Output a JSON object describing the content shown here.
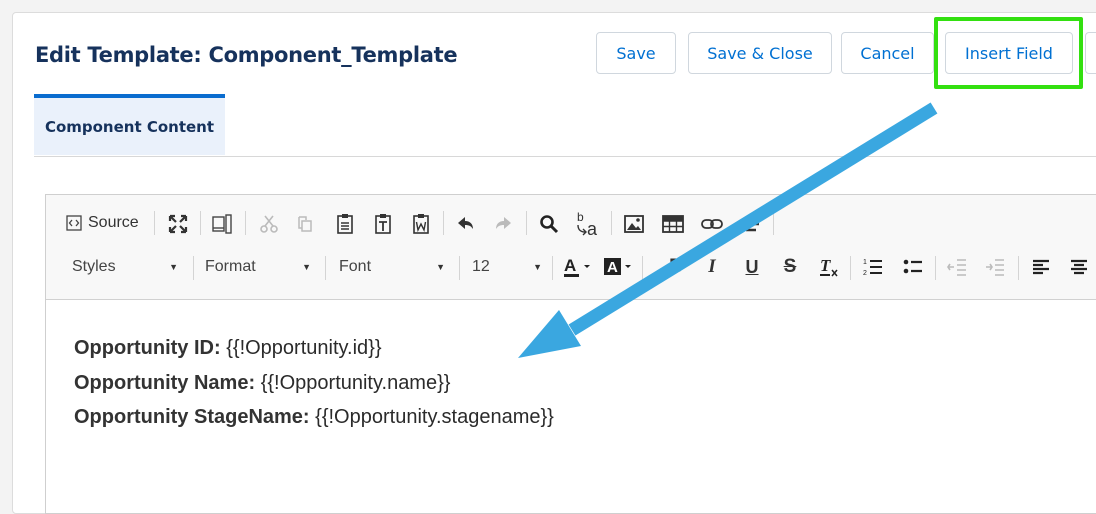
{
  "header": {
    "title": "Edit Template: Component_Template",
    "buttons": {
      "save": "Save",
      "save_close": "Save & Close",
      "cancel": "Cancel",
      "insert_field": "Insert Field"
    }
  },
  "tabs": [
    {
      "label": "Component Content",
      "active": true
    }
  ],
  "toolbar": {
    "source_label": "Source",
    "styles_label": "Styles",
    "format_label": "Format",
    "font_label": "Font",
    "size_value": "12",
    "icons": [
      "source-icon",
      "maximize-icon",
      "show-blocks-icon",
      "cut-icon",
      "copy-icon",
      "paste-icon",
      "paste-text-icon",
      "paste-word-icon",
      "undo-icon",
      "redo-icon",
      "find-icon",
      "replace-icon",
      "image-icon",
      "table-icon",
      "link-icon",
      "horizontal-rule-icon",
      "text-color-icon",
      "background-color-icon",
      "bold-icon",
      "italic-icon",
      "underline-icon",
      "strikethrough-icon",
      "remove-format-icon",
      "numbered-list-icon",
      "bulleted-list-icon",
      "decrease-indent-icon",
      "increase-indent-icon",
      "align-left-icon",
      "align-center-icon"
    ]
  },
  "content": {
    "lines": [
      {
        "label": "Opportunity ID:",
        "value": "{{!Opportunity.id}}"
      },
      {
        "label": "Opportunity Name:",
        "value": "{{!Opportunity.name}}"
      },
      {
        "label": "Opportunity StageName:",
        "value": "{{!Opportunity.stagename}}"
      }
    ]
  },
  "annotation": {
    "highlight_color": "#33e010",
    "arrow_color": "#3aa7e0"
  }
}
